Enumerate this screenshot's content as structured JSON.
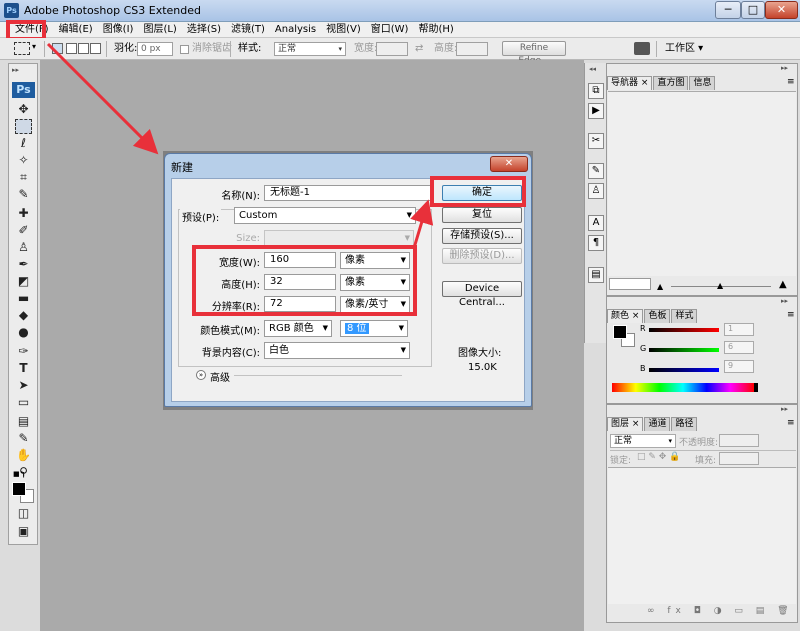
{
  "window": {
    "title": "Adobe Photoshop CS3 Extended",
    "logo": "Ps",
    "min": "─",
    "max": "□",
    "close": "✕"
  },
  "menu": [
    "文件(F)",
    "编辑(E)",
    "图像(I)",
    "图层(L)",
    "选择(S)",
    "滤镜(T)",
    "Analysis",
    "视图(V)",
    "窗口(W)",
    "帮助(H)"
  ],
  "options": {
    "feather_label": "羽化:",
    "feather_value": "0 px",
    "antialias_label": "消除锯齿",
    "style_label": "样式:",
    "style_value": "正常",
    "width_label": "宽度:",
    "height_label": "高度:",
    "refine_edge": "Refine Edge...",
    "workspace": "工作区 ▾"
  },
  "toolbox": {
    "logo": "Ps"
  },
  "navigator": {
    "tabs": [
      "导航器",
      "直方图",
      "信息"
    ]
  },
  "color_panel": {
    "tabs": [
      "颜色",
      "色板",
      "样式"
    ],
    "channels": [
      {
        "label": "R",
        "value": "1",
        "color": "#ff0000"
      },
      {
        "label": "G",
        "value": "6",
        "color": "#00ff00"
      },
      {
        "label": "B",
        "value": "9",
        "color": "#0000ff"
      }
    ]
  },
  "layers_panel": {
    "tabs": [
      "图层",
      "通道",
      "路径"
    ],
    "blend_mode": "正常",
    "opacity_label": "不透明度:",
    "lock_label": "锁定:",
    "fill_label": "填充:"
  },
  "dialog": {
    "title": "新建",
    "close": "✕",
    "name_label": "名称(N):",
    "name_value": "无标题-1",
    "preset_label": "预设(P):",
    "preset_value": "Custom",
    "size_label": "Size:",
    "width_label": "宽度(W):",
    "width_value": "160",
    "width_unit": "像素",
    "height_label": "高度(H):",
    "height_value": "32",
    "height_unit": "像素",
    "resolution_label": "分辨率(R):",
    "resolution_value": "72",
    "resolution_unit": "像素/英寸",
    "color_mode_label": "颜色模式(M):",
    "color_mode_value": "RGB 颜色",
    "bit_depth": "8 位",
    "background_label": "背景内容(C):",
    "background_value": "白色",
    "advanced_label": "高级",
    "ok": "确定",
    "reset": "复位",
    "save_preset": "存储预设(S)...",
    "delete_preset": "删除预设(D)...",
    "device_central": "Device Central...",
    "image_size_label": "图像大小:",
    "image_size_value": "15.0K"
  }
}
